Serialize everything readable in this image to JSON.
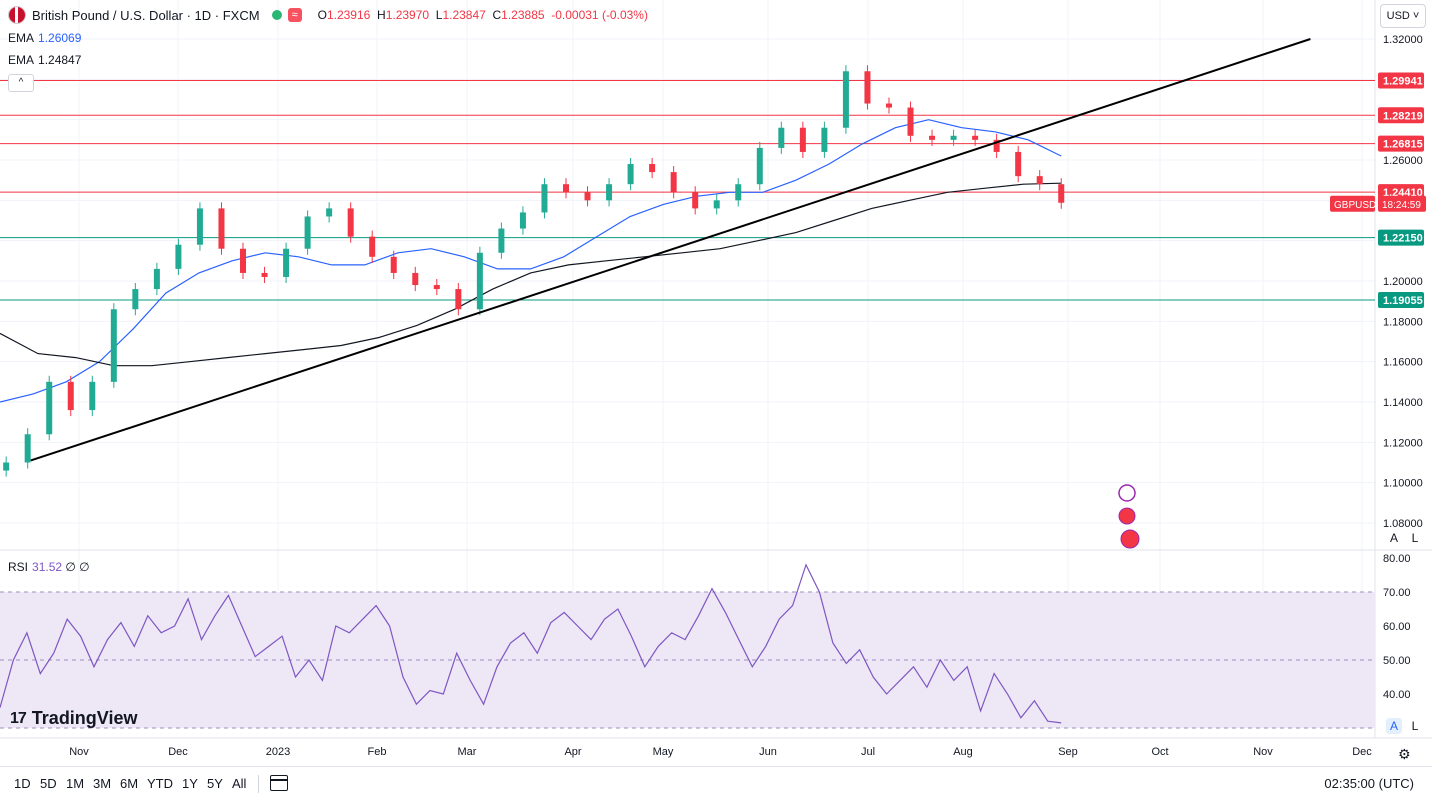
{
  "header": {
    "symbol_title": "British Pound / U.S. Dollar · 1D · FXCM",
    "ohlc": {
      "o_label": "O",
      "o": "1.23916",
      "h_label": "H",
      "h": "1.23970",
      "l_label": "L",
      "l": "1.23847",
      "c_label": "C",
      "c": "1.23885",
      "change": "-0.00031 (-0.03%)"
    },
    "wave_icon": "≈",
    "currency": "USD"
  },
  "indicators": {
    "ema1_label": "EMA",
    "ema1_value": "1.26069",
    "ema2_label": "EMA",
    "ema2_value": "1.24847",
    "collapse_icon": "^",
    "rsi_label": "RSI",
    "rsi_value": "31.52",
    "rsi_extra": "∅ ∅"
  },
  "price_scale": {
    "ticks": [
      "1.32000",
      "1.26000",
      "1.20000",
      "1.18000",
      "1.16000",
      "1.14000",
      "1.12000",
      "1.10000",
      "1.08000"
    ],
    "level_labels": [
      "1.29941",
      "1.28219",
      "1.26815",
      "1.24410",
      "1.22150",
      "1.19055"
    ],
    "last_symbol": "GBPUSD",
    "countdown": "18:24:59",
    "a_label": "A",
    "l_label": "L"
  },
  "rsi_scale": {
    "ticks": [
      "80.00",
      "70.00",
      "60.00",
      "50.00",
      "40.00"
    ]
  },
  "time_axis": [
    "Nov",
    "Dec",
    "2023",
    "Feb",
    "Mar",
    "Apr",
    "May",
    "Jun",
    "Jul",
    "Aug",
    "Sep",
    "Oct",
    "Nov",
    "Dec"
  ],
  "brand": "TradingView",
  "bottom_bar": {
    "timeframes": [
      "1D",
      "5D",
      "1M",
      "3M",
      "6M",
      "YTD",
      "1Y",
      "5Y",
      "All"
    ],
    "clock": "02:35:00 (UTC)"
  },
  "colors": {
    "up": "#22ab94",
    "down": "#f23645",
    "ema_fast": "#2962ff",
    "ema_slow": "#131722",
    "resistance": "#f23645",
    "support": "#089981",
    "rsi": "#7e57c2",
    "rsi_band": "#ede7f6"
  },
  "chart_data": [
    {
      "type": "candlestick",
      "title": "British Pound / U.S. Dollar · 1D · FXCM",
      "ylim": [
        1.08,
        1.32
      ],
      "x_range": [
        "2022-10-10",
        "2023-12-31"
      ],
      "candles": [
        {
          "date": "2022-10-12",
          "close": 1.11
        },
        {
          "date": "2022-10-19",
          "close": 1.124
        },
        {
          "date": "2022-10-26",
          "close": 1.15
        },
        {
          "date": "2022-11-02",
          "close": 1.136
        },
        {
          "date": "2022-11-09",
          "close": 1.15
        },
        {
          "date": "2022-11-16",
          "close": 1.186
        },
        {
          "date": "2022-11-23",
          "close": 1.196
        },
        {
          "date": "2022-11-30",
          "close": 1.206
        },
        {
          "date": "2022-12-07",
          "close": 1.218
        },
        {
          "date": "2022-12-14",
          "close": 1.236
        },
        {
          "date": "2022-12-21",
          "close": 1.216
        },
        {
          "date": "2022-12-28",
          "close": 1.204
        },
        {
          "date": "2023-01-04",
          "close": 1.202
        },
        {
          "date": "2023-01-11",
          "close": 1.216
        },
        {
          "date": "2023-01-18",
          "close": 1.232
        },
        {
          "date": "2023-01-25",
          "close": 1.236
        },
        {
          "date": "2023-02-01",
          "close": 1.222
        },
        {
          "date": "2023-02-08",
          "close": 1.212
        },
        {
          "date": "2023-02-15",
          "close": 1.204
        },
        {
          "date": "2023-02-22",
          "close": 1.198
        },
        {
          "date": "2023-03-01",
          "close": 1.196
        },
        {
          "date": "2023-03-08",
          "close": 1.186
        },
        {
          "date": "2023-03-15",
          "close": 1.214
        },
        {
          "date": "2023-03-22",
          "close": 1.226
        },
        {
          "date": "2023-03-29",
          "close": 1.234
        },
        {
          "date": "2023-04-05",
          "close": 1.248
        },
        {
          "date": "2023-04-12",
          "close": 1.244
        },
        {
          "date": "2023-04-19",
          "close": 1.24
        },
        {
          "date": "2023-04-26",
          "close": 1.248
        },
        {
          "date": "2023-05-03",
          "close": 1.258
        },
        {
          "date": "2023-05-10",
          "close": 1.254
        },
        {
          "date": "2023-05-17",
          "close": 1.244
        },
        {
          "date": "2023-05-24",
          "close": 1.236
        },
        {
          "date": "2023-05-31",
          "close": 1.24
        },
        {
          "date": "2023-06-07",
          "close": 1.248
        },
        {
          "date": "2023-06-14",
          "close": 1.266
        },
        {
          "date": "2023-06-21",
          "close": 1.276
        },
        {
          "date": "2023-06-28",
          "close": 1.264
        },
        {
          "date": "2023-07-05",
          "close": 1.276
        },
        {
          "date": "2023-07-12",
          "close": 1.304
        },
        {
          "date": "2023-07-19",
          "close": 1.288
        },
        {
          "date": "2023-07-26",
          "close": 1.286
        },
        {
          "date": "2023-08-02",
          "close": 1.272
        },
        {
          "date": "2023-08-09",
          "close": 1.27
        },
        {
          "date": "2023-08-16",
          "close": 1.272
        },
        {
          "date": "2023-08-23",
          "close": 1.27
        },
        {
          "date": "2023-08-30",
          "close": 1.264
        },
        {
          "date": "2023-09-06",
          "close": 1.252
        },
        {
          "date": "2023-09-13",
          "close": 1.248
        },
        {
          "date": "2023-09-20",
          "close": 1.2388
        }
      ],
      "horizontal_levels": {
        "resistance": [
          1.29941,
          1.28219,
          1.26815,
          1.2441
        ],
        "support": [
          1.2215,
          1.19055
        ]
      },
      "trendline": {
        "start": {
          "date": "2022-10-20",
          "price": 1.111
        },
        "end": {
          "date": "2023-12-10",
          "price": 1.32
        }
      },
      "series": [
        {
          "name": "EMA",
          "last": 1.26069,
          "values": [
            1.14,
            1.144,
            1.15,
            1.16,
            1.176,
            1.194,
            1.204,
            1.21,
            1.214,
            1.212,
            1.208,
            1.208,
            1.214,
            1.216,
            1.212,
            1.206,
            1.206,
            1.212,
            1.222,
            1.232,
            1.238,
            1.242,
            1.244,
            1.244,
            1.25,
            1.258,
            1.268,
            1.276,
            1.28,
            1.276,
            1.274,
            1.27,
            1.262
          ]
        },
        {
          "name": "EMA",
          "last": 1.24847,
          "values": [
            1.174,
            1.164,
            1.162,
            1.158,
            1.158,
            1.16,
            1.162,
            1.164,
            1.166,
            1.168,
            1.172,
            1.178,
            1.186,
            1.196,
            1.204,
            1.208,
            1.21,
            1.212,
            1.214,
            1.216,
            1.22,
            1.224,
            1.23,
            1.236,
            1.24,
            1.244,
            1.246,
            1.248,
            1.2485
          ]
        }
      ]
    },
    {
      "type": "line",
      "title": "RSI",
      "last": 31.52,
      "ylim": [
        30,
        80
      ],
      "bands": [
        30,
        50,
        70
      ],
      "values": [
        36,
        50,
        58,
        46,
        52,
        62,
        57,
        48,
        56,
        61,
        54,
        63,
        58,
        60,
        68,
        56,
        63,
        69,
        60,
        51,
        54,
        57,
        45,
        50,
        44,
        60,
        58,
        62,
        66,
        60,
        45,
        37,
        41,
        40,
        52,
        44,
        37,
        48,
        55,
        58,
        52,
        61,
        64,
        60,
        56,
        62,
        65,
        57,
        48,
        54,
        58,
        56,
        63,
        71,
        64,
        56,
        48,
        54,
        62,
        66,
        78,
        70,
        55,
        49,
        53,
        45,
        40,
        44,
        48,
        42,
        50,
        44,
        48,
        35,
        46,
        40,
        33,
        38,
        32,
        31.5
      ]
    }
  ]
}
